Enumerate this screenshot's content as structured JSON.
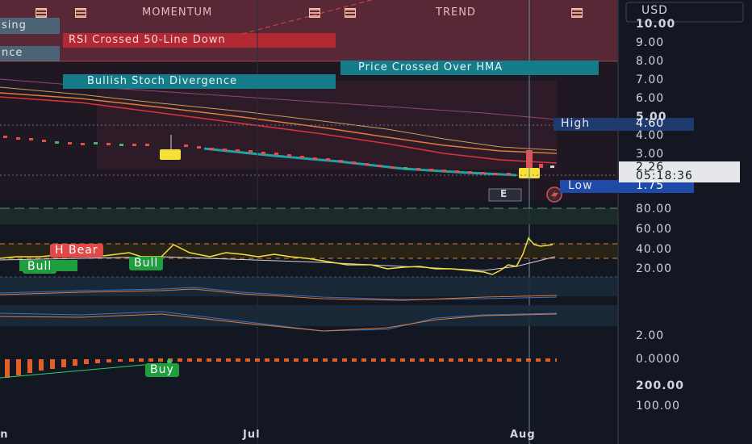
{
  "header": {
    "momentum_label": "MOMENTUM",
    "trend_label": "TREND",
    "left_tag_top": "sing",
    "left_tag_bottom": "nce"
  },
  "alerts": {
    "rsi": "RSI Crossed 50-Line Down",
    "hma": "Price Crossed Over HMA",
    "stoch": "Bullish Stoch Divergence"
  },
  "currency": "USD",
  "price_axis": [
    "10.00",
    "9.00",
    "8.00",
    "7.00",
    "6.00",
    "5.00",
    "4.00",
    "3.00"
  ],
  "high": {
    "label": "High",
    "value": "4.60"
  },
  "low": {
    "label": "Low",
    "value": "1.75"
  },
  "current": {
    "price": "2.26",
    "countdown": "05:18:36"
  },
  "earnings_badge": "E",
  "rsi_panel": {
    "axis": [
      "80.00",
      "60.00",
      "40.00",
      "20.00"
    ],
    "labels": {
      "bear": "H Bear",
      "bull1": "Bull",
      "bull2": "Bull"
    },
    "line_points": [
      [
        0,
        320
      ],
      [
        20,
        318
      ],
      [
        50,
        318
      ],
      [
        80,
        315
      ],
      [
        120,
        318
      ],
      [
        160,
        313
      ],
      [
        175,
        318
      ],
      [
        200,
        318
      ],
      [
        215,
        303
      ],
      [
        235,
        313
      ],
      [
        260,
        318
      ],
      [
        280,
        313
      ],
      [
        300,
        315
      ],
      [
        320,
        318
      ],
      [
        340,
        315
      ],
      [
        360,
        318
      ],
      [
        380,
        320
      ],
      [
        400,
        323
      ],
      [
        430,
        328
      ],
      [
        460,
        328
      ],
      [
        480,
        333
      ],
      [
        500,
        331
      ],
      [
        520,
        330
      ],
      [
        540,
        333
      ],
      [
        560,
        333
      ],
      [
        580,
        335
      ],
      [
        600,
        337
      ],
      [
        610,
        340
      ],
      [
        620,
        335
      ],
      [
        630,
        328
      ],
      [
        640,
        330
      ],
      [
        648,
        315
      ],
      [
        655,
        295
      ],
      [
        662,
        303
      ],
      [
        670,
        305
      ],
      [
        685,
        303
      ]
    ],
    "signal_points": [
      [
        0,
        322
      ],
      [
        200,
        318
      ],
      [
        400,
        325
      ],
      [
        560,
        333
      ],
      [
        600,
        335
      ],
      [
        640,
        330
      ],
      [
        660,
        325
      ],
      [
        688,
        318
      ]
    ]
  },
  "osc_axis": [
    "2.00",
    "0.0000"
  ],
  "macd_label": "Buy",
  "volume_axis": [
    "200.00",
    "100.00"
  ],
  "x_axis": [
    "Jun",
    "Jul",
    "Aug"
  ],
  "colors": {
    "background": "#131722",
    "alert_red": "#b22833",
    "alert_teal": "#167c8a",
    "bull_green": "#1e9e3f",
    "bear_red": "#e34848",
    "rsi_yellow": "#f5e03a",
    "high_box": "#1e3a6e",
    "low_box": "#1f4aa8"
  },
  "chart_data": {
    "type": "line",
    "series": [],
    "x_ticks": [
      "Jun",
      "Jul",
      "Aug"
    ],
    "y_ticks_price": [
      "3.00",
      "4.00",
      "5.00",
      "6.00",
      "7.00",
      "8.00",
      "9.00",
      "10.00"
    ],
    "high": 4.6,
    "low": 1.75,
    "last": 2.26,
    "rsi_ticks": [
      "20.00",
      "40.00",
      "60.00",
      "80.00"
    ],
    "volume_ticks": [
      "100.00",
      "200.00"
    ]
  }
}
